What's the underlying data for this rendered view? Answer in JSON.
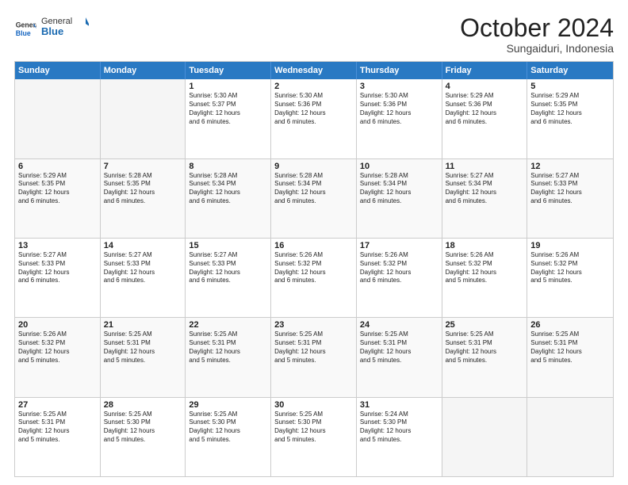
{
  "logo": {
    "general": "General",
    "blue": "Blue"
  },
  "header": {
    "month": "October 2024",
    "location": "Sungaiduri, Indonesia"
  },
  "weekdays": [
    "Sunday",
    "Monday",
    "Tuesday",
    "Wednesday",
    "Thursday",
    "Friday",
    "Saturday"
  ],
  "rows": [
    [
      {
        "day": "",
        "empty": true
      },
      {
        "day": "",
        "empty": true
      },
      {
        "day": "1",
        "lines": [
          "Sunrise: 5:30 AM",
          "Sunset: 5:37 PM",
          "Daylight: 12 hours",
          "and 6 minutes."
        ]
      },
      {
        "day": "2",
        "lines": [
          "Sunrise: 5:30 AM",
          "Sunset: 5:36 PM",
          "Daylight: 12 hours",
          "and 6 minutes."
        ]
      },
      {
        "day": "3",
        "lines": [
          "Sunrise: 5:30 AM",
          "Sunset: 5:36 PM",
          "Daylight: 12 hours",
          "and 6 minutes."
        ]
      },
      {
        "day": "4",
        "lines": [
          "Sunrise: 5:29 AM",
          "Sunset: 5:36 PM",
          "Daylight: 12 hours",
          "and 6 minutes."
        ]
      },
      {
        "day": "5",
        "lines": [
          "Sunrise: 5:29 AM",
          "Sunset: 5:35 PM",
          "Daylight: 12 hours",
          "and 6 minutes."
        ]
      }
    ],
    [
      {
        "day": "6",
        "lines": [
          "Sunrise: 5:29 AM",
          "Sunset: 5:35 PM",
          "Daylight: 12 hours",
          "and 6 minutes."
        ]
      },
      {
        "day": "7",
        "lines": [
          "Sunrise: 5:28 AM",
          "Sunset: 5:35 PM",
          "Daylight: 12 hours",
          "and 6 minutes."
        ]
      },
      {
        "day": "8",
        "lines": [
          "Sunrise: 5:28 AM",
          "Sunset: 5:34 PM",
          "Daylight: 12 hours",
          "and 6 minutes."
        ]
      },
      {
        "day": "9",
        "lines": [
          "Sunrise: 5:28 AM",
          "Sunset: 5:34 PM",
          "Daylight: 12 hours",
          "and 6 minutes."
        ]
      },
      {
        "day": "10",
        "lines": [
          "Sunrise: 5:28 AM",
          "Sunset: 5:34 PM",
          "Daylight: 12 hours",
          "and 6 minutes."
        ]
      },
      {
        "day": "11",
        "lines": [
          "Sunrise: 5:27 AM",
          "Sunset: 5:34 PM",
          "Daylight: 12 hours",
          "and 6 minutes."
        ]
      },
      {
        "day": "12",
        "lines": [
          "Sunrise: 5:27 AM",
          "Sunset: 5:33 PM",
          "Daylight: 12 hours",
          "and 6 minutes."
        ]
      }
    ],
    [
      {
        "day": "13",
        "lines": [
          "Sunrise: 5:27 AM",
          "Sunset: 5:33 PM",
          "Daylight: 12 hours",
          "and 6 minutes."
        ]
      },
      {
        "day": "14",
        "lines": [
          "Sunrise: 5:27 AM",
          "Sunset: 5:33 PM",
          "Daylight: 12 hours",
          "and 6 minutes."
        ]
      },
      {
        "day": "15",
        "lines": [
          "Sunrise: 5:27 AM",
          "Sunset: 5:33 PM",
          "Daylight: 12 hours",
          "and 6 minutes."
        ]
      },
      {
        "day": "16",
        "lines": [
          "Sunrise: 5:26 AM",
          "Sunset: 5:32 PM",
          "Daylight: 12 hours",
          "and 6 minutes."
        ]
      },
      {
        "day": "17",
        "lines": [
          "Sunrise: 5:26 AM",
          "Sunset: 5:32 PM",
          "Daylight: 12 hours",
          "and 6 minutes."
        ]
      },
      {
        "day": "18",
        "lines": [
          "Sunrise: 5:26 AM",
          "Sunset: 5:32 PM",
          "Daylight: 12 hours",
          "and 5 minutes."
        ]
      },
      {
        "day": "19",
        "lines": [
          "Sunrise: 5:26 AM",
          "Sunset: 5:32 PM",
          "Daylight: 12 hours",
          "and 5 minutes."
        ]
      }
    ],
    [
      {
        "day": "20",
        "lines": [
          "Sunrise: 5:26 AM",
          "Sunset: 5:32 PM",
          "Daylight: 12 hours",
          "and 5 minutes."
        ]
      },
      {
        "day": "21",
        "lines": [
          "Sunrise: 5:25 AM",
          "Sunset: 5:31 PM",
          "Daylight: 12 hours",
          "and 5 minutes."
        ]
      },
      {
        "day": "22",
        "lines": [
          "Sunrise: 5:25 AM",
          "Sunset: 5:31 PM",
          "Daylight: 12 hours",
          "and 5 minutes."
        ]
      },
      {
        "day": "23",
        "lines": [
          "Sunrise: 5:25 AM",
          "Sunset: 5:31 PM",
          "Daylight: 12 hours",
          "and 5 minutes."
        ]
      },
      {
        "day": "24",
        "lines": [
          "Sunrise: 5:25 AM",
          "Sunset: 5:31 PM",
          "Daylight: 12 hours",
          "and 5 minutes."
        ]
      },
      {
        "day": "25",
        "lines": [
          "Sunrise: 5:25 AM",
          "Sunset: 5:31 PM",
          "Daylight: 12 hours",
          "and 5 minutes."
        ]
      },
      {
        "day": "26",
        "lines": [
          "Sunrise: 5:25 AM",
          "Sunset: 5:31 PM",
          "Daylight: 12 hours",
          "and 5 minutes."
        ]
      }
    ],
    [
      {
        "day": "27",
        "lines": [
          "Sunrise: 5:25 AM",
          "Sunset: 5:31 PM",
          "Daylight: 12 hours",
          "and 5 minutes."
        ]
      },
      {
        "day": "28",
        "lines": [
          "Sunrise: 5:25 AM",
          "Sunset: 5:30 PM",
          "Daylight: 12 hours",
          "and 5 minutes."
        ]
      },
      {
        "day": "29",
        "lines": [
          "Sunrise: 5:25 AM",
          "Sunset: 5:30 PM",
          "Daylight: 12 hours",
          "and 5 minutes."
        ]
      },
      {
        "day": "30",
        "lines": [
          "Sunrise: 5:25 AM",
          "Sunset: 5:30 PM",
          "Daylight: 12 hours",
          "and 5 minutes."
        ]
      },
      {
        "day": "31",
        "lines": [
          "Sunrise: 5:24 AM",
          "Sunset: 5:30 PM",
          "Daylight: 12 hours",
          "and 5 minutes."
        ]
      },
      {
        "day": "",
        "empty": true
      },
      {
        "day": "",
        "empty": true
      }
    ]
  ]
}
